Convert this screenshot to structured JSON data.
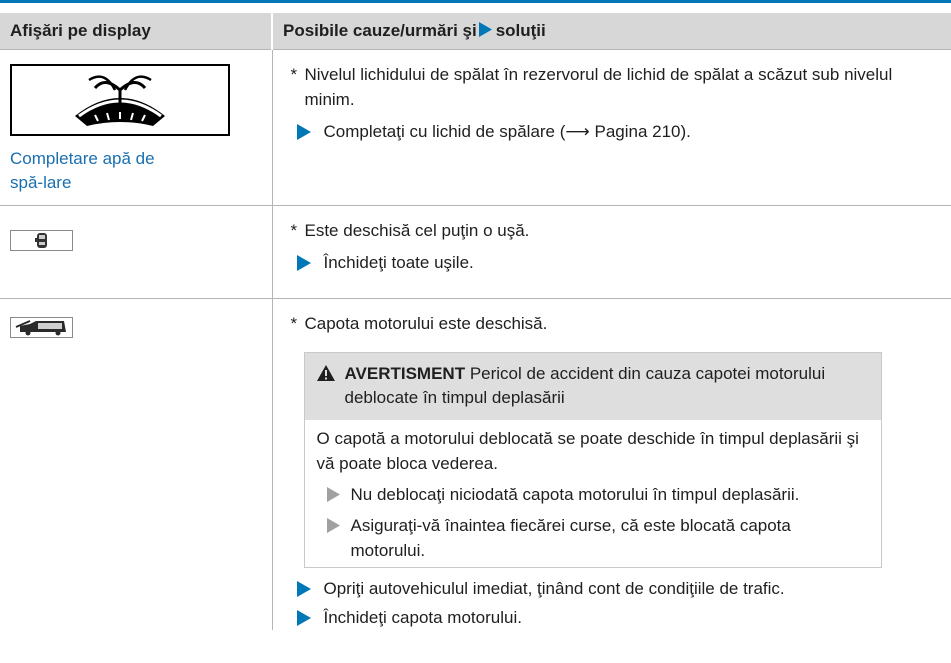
{
  "table": {
    "header": {
      "col1": "Afişări pe display",
      "col2_before": "Posibile cauze/urmări şi",
      "col2_after": "soluţii"
    },
    "rows": [
      {
        "display_icon": "windshield-washer-fluid-icon",
        "display_message": "Completare apă de spă-lare",
        "cause": "Nivelul lichidului de spălat în rezervorul de lichid de spălat a scăzut sub nivelul minim.",
        "actions": [
          "Completaţi cu lichid de spălare (⟶ Pagina 210)."
        ]
      },
      {
        "display_icon": "door-open-icon",
        "cause": "Este deschisă cel puţin o uşă.",
        "actions": [
          "Închideţi toate uşile."
        ]
      },
      {
        "display_icon": "hood-open-icon",
        "cause": "Capota motorului este deschisă.",
        "warning": {
          "label": "AVERTISMENT",
          "title": "Pericol de accident din cauza capotei motorului deblocate în timpul deplasării",
          "body": "O capotă a motorului deblocată se poate deschide în timpul deplasării şi vă poate bloca vederea.",
          "items": [
            "Nu deblocaţi niciodată capota motorului în timpul deplasării.",
            "Asiguraţi-vă înaintea fiecărei curse, că este blocată capota motorului."
          ]
        },
        "actions": [
          "Opriţi autovehiculul imediat, ţinând cont de condiţiile de trafic.",
          "Închideţi capota motorului."
        ]
      }
    ]
  },
  "colors": {
    "accent": "#0077b6",
    "header_bg": "#d7d7d7",
    "link": "#1a6fb0",
    "warning_head_bg": "#dedede",
    "warning_bullet": "#a0a0a0"
  }
}
